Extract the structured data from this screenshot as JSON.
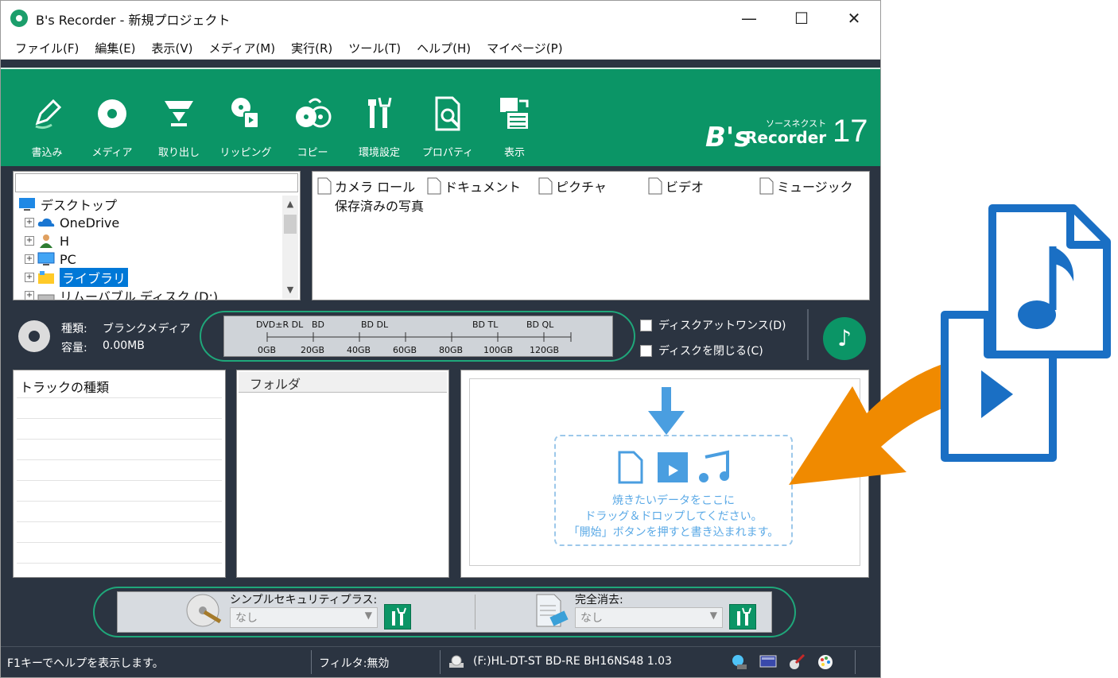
{
  "window": {
    "title": "B's Recorder - 新規プロジェクト"
  },
  "menu": [
    "ファイル(F)",
    "編集(E)",
    "表示(V)",
    "メディア(M)",
    "実行(R)",
    "ツール(T)",
    "ヘルプ(H)",
    "マイページ(P)"
  ],
  "toolbar": {
    "buttons": [
      {
        "label": "書込み",
        "icon": "pen-icon"
      },
      {
        "label": "メディア",
        "icon": "disc-icon"
      },
      {
        "label": "取り出し",
        "icon": "eject-icon"
      },
      {
        "label": "リッピング",
        "icon": "ripping-icon"
      },
      {
        "label": "コピー",
        "icon": "copy-disc-icon"
      },
      {
        "label": "環境設定",
        "icon": "tools-icon"
      },
      {
        "label": "プロパティ",
        "icon": "properties-icon"
      },
      {
        "label": "表示",
        "icon": "display-icon"
      }
    ],
    "logo": {
      "brand": "B's",
      "sub": "ソースネクスト",
      "product": "Recorder",
      "version": "17"
    }
  },
  "tree": {
    "items": [
      {
        "label": "デスクトップ",
        "icon": "desktop-icon"
      },
      {
        "label": "OneDrive",
        "icon": "cloud-icon"
      },
      {
        "label": "H",
        "icon": "user-icon"
      },
      {
        "label": "PC",
        "icon": "pc-icon"
      },
      {
        "label": "ライブラリ",
        "icon": "library-icon"
      },
      {
        "label": "リムーバブル ディスク (D:)",
        "icon": "drive-icon"
      }
    ]
  },
  "files": {
    "items": [
      "カメラ ロール",
      "ドキュメント",
      "ピクチャ",
      "ビデオ",
      "ミュージック"
    ],
    "extra": "保存済みの写真"
  },
  "disc": {
    "type_label": "種類:",
    "type_value": "ブランクメディア",
    "capacity_label": "容量:",
    "capacity_value": "0.00MB",
    "gauge_top": [
      "DVD±R DL",
      "BD",
      "BD DL",
      "BD TL",
      "BD QL"
    ],
    "gauge_bottom": [
      "0GB",
      "20GB",
      "40GB",
      "60GB",
      "80GB",
      "100GB",
      "120GB"
    ],
    "options": [
      "ディスクアットワンス(D)",
      "ディスクを閉じる(C)"
    ]
  },
  "panels": {
    "track_header": "トラックの種類",
    "folder_header": "フォルダ",
    "drop_lines": [
      "焼きたいデータをここに",
      "ドラッグ＆ドロップしてください。",
      "「開始」ボタンを押すと書き込まれます。"
    ]
  },
  "security": {
    "simple_label": "シンプルセキュリティプラス:",
    "simple_value": "なし",
    "erase_label": "完全消去:",
    "erase_value": "なし"
  },
  "status": {
    "help": "F1キーでヘルプを表示します。",
    "filter": "フィルタ:無効",
    "drive": "(F:)HL-DT-ST BD-RE  BH16NS48  1.03"
  },
  "colors": {
    "accent": "#0b9566",
    "dark": "#2b3441",
    "drop": "#5aa9e6",
    "arrow": "#f08a00",
    "doc": "#1a6fc4"
  }
}
